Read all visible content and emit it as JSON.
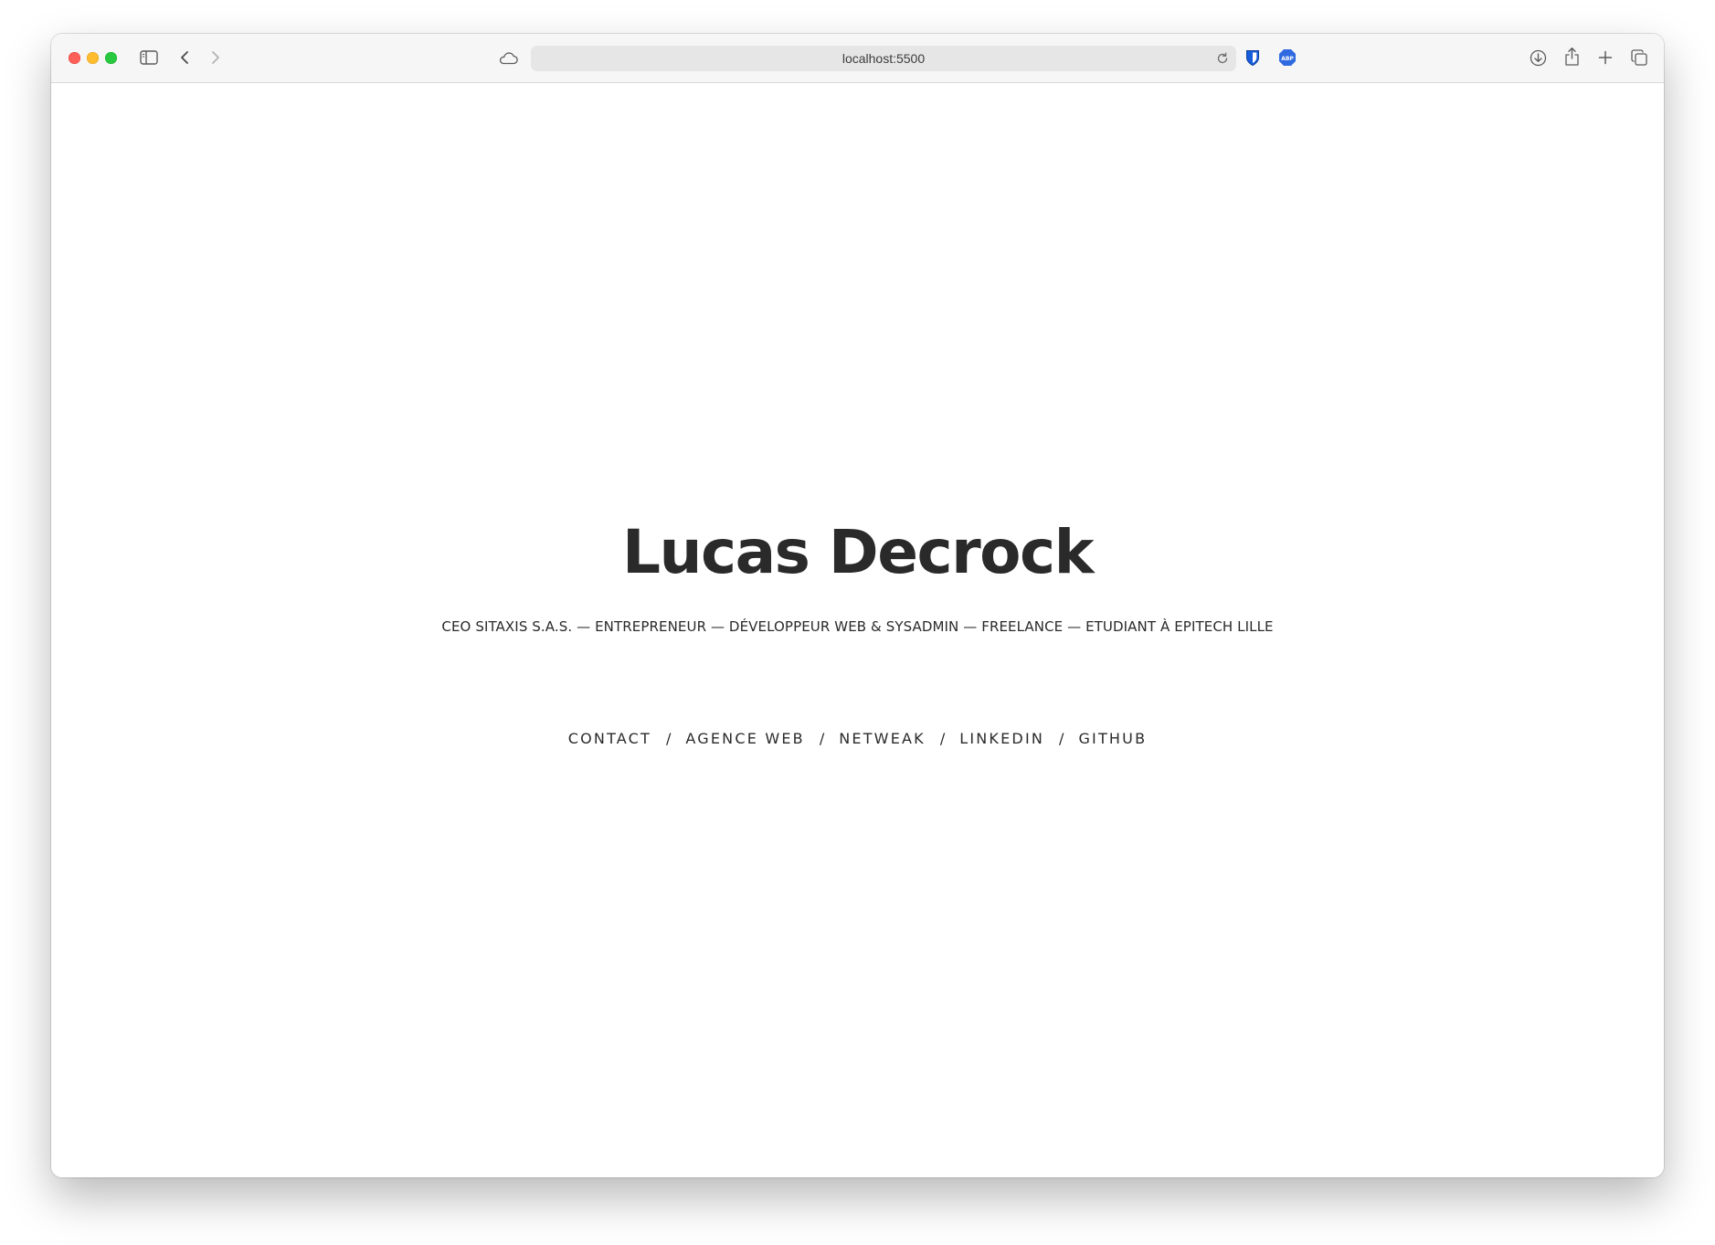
{
  "browser": {
    "url": "localhost:5500",
    "icons": {
      "sidebar": "sidebar-icon",
      "back": "chevron-left-icon",
      "forward": "chevron-right-icon",
      "icloud": "cloud-icon",
      "reload": "reload-icon",
      "bitwarden": "shield-icon",
      "adblock": "abp-icon",
      "adblock_label": "ABP",
      "downloads": "download-icon",
      "share": "share-icon",
      "new_tab": "plus-icon",
      "tabs": "tabs-overview-icon"
    }
  },
  "page": {
    "title": "Lucas Decrock",
    "subtitle": "CEO SITAXIS S.A.S. — ENTREPRENEUR — DÉVELOPPEUR WEB & SYSADMIN — FREELANCE — ETUDIANT À EPITECH LILLE",
    "nav": {
      "items": [
        {
          "label": "CONTACT"
        },
        {
          "label": "AGENCE WEB"
        },
        {
          "label": "NETWEAK"
        },
        {
          "label": "LINKEDIN"
        },
        {
          "label": "GITHUB"
        }
      ],
      "separator": "/"
    }
  },
  "colors": {
    "text": "#2a2a2a",
    "background": "#ffffff",
    "toolbar": "#f6f6f6",
    "address_bar": "#e6e6e7",
    "abp_blue": "#2f6ae0",
    "bitwarden_blue": "#175ddc"
  }
}
